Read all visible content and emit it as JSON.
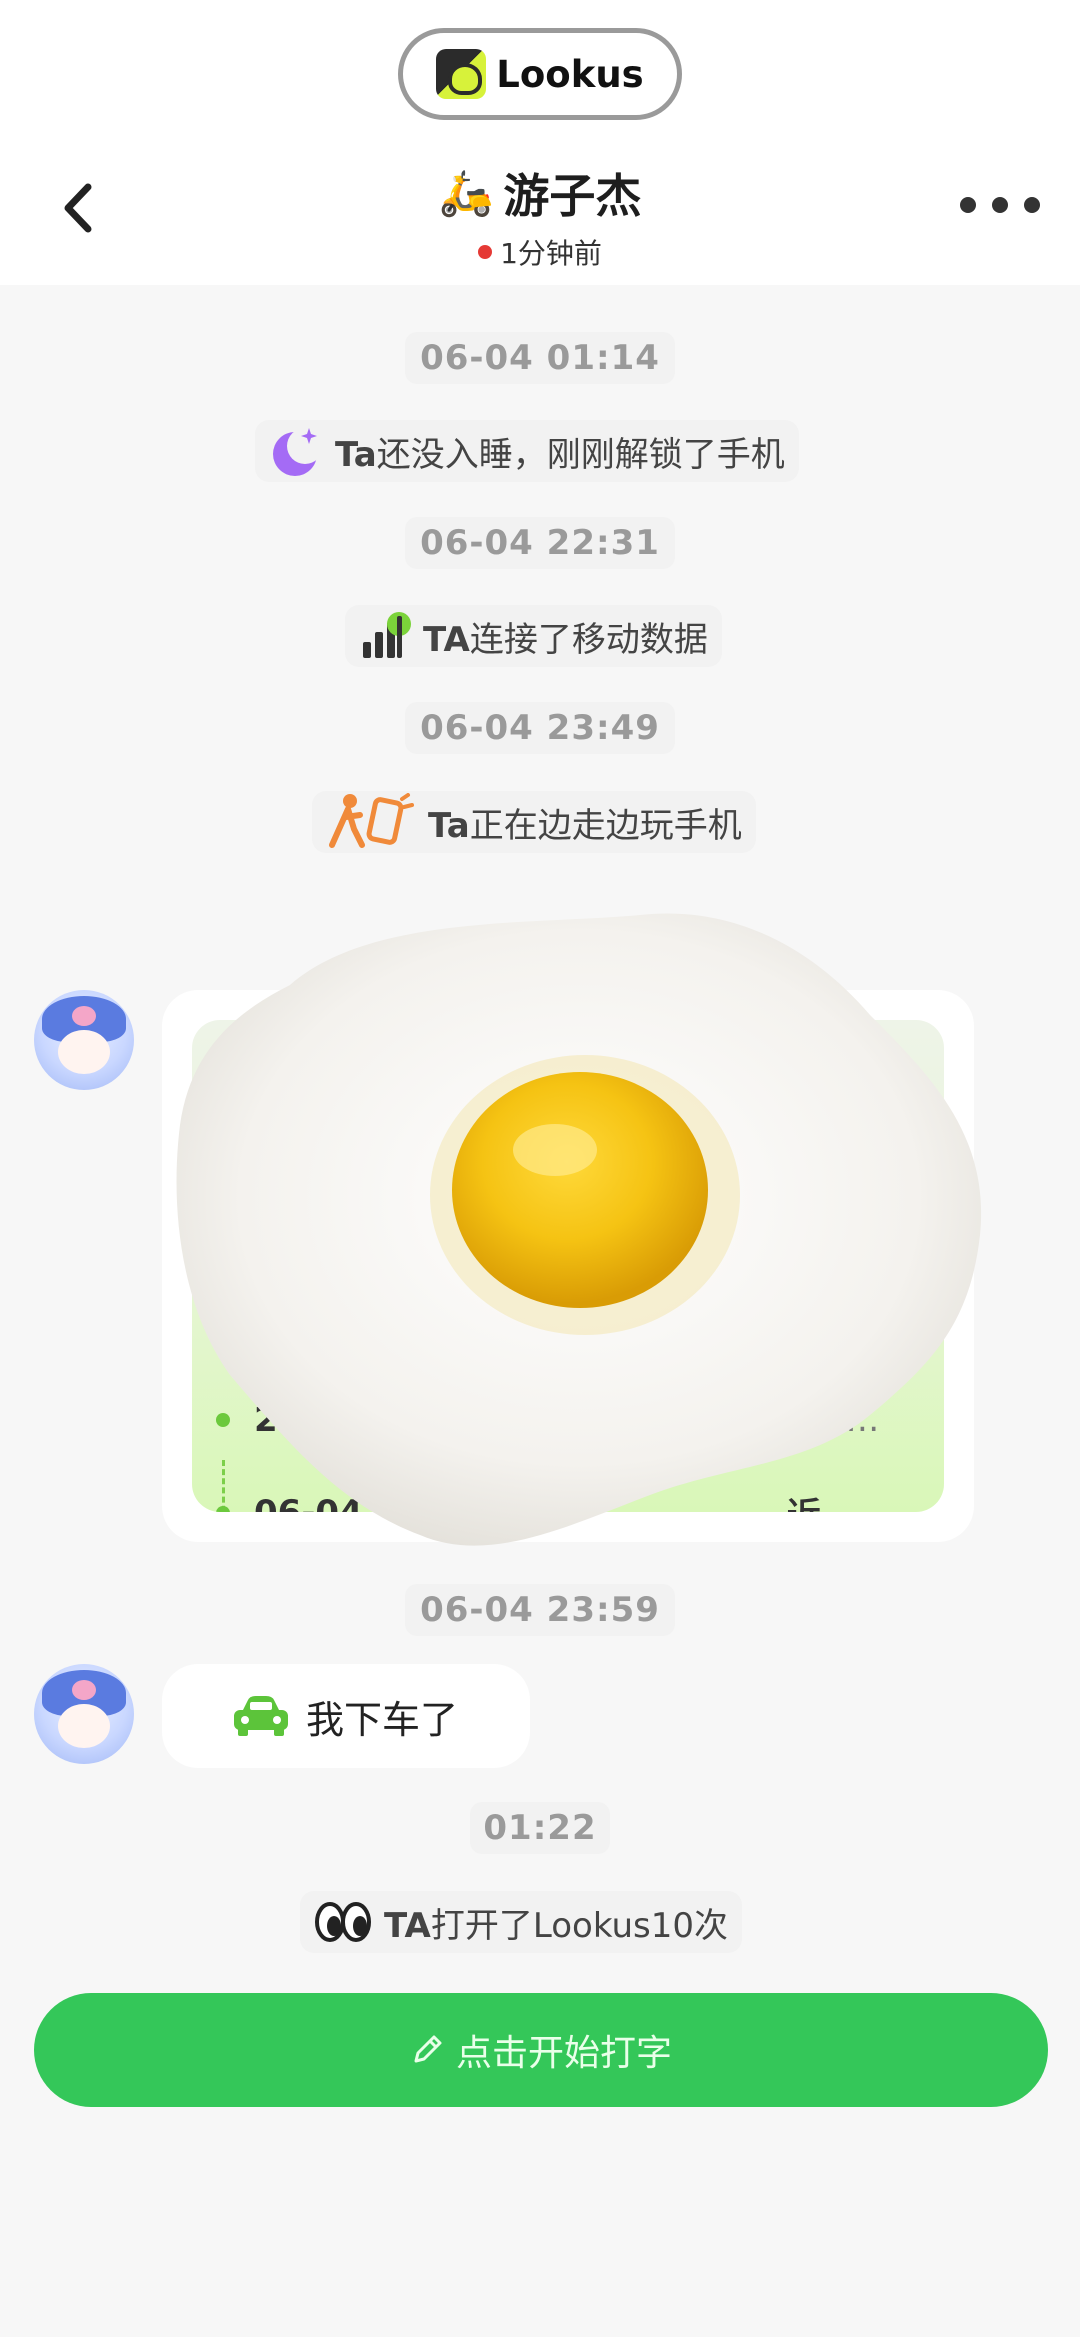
{
  "app": {
    "name": "Lookus"
  },
  "header": {
    "title_emoji": "🛵",
    "title": "游子杰",
    "status": "1分钟前",
    "status_color": "#e53935"
  },
  "timeline": [
    {
      "time": "06-04 01:14",
      "event": {
        "icon": "moon-icon",
        "prefix": "Ta",
        "text": "还没入睡，刚刚解锁了手机"
      }
    },
    {
      "time": "06-04 22:31",
      "event": {
        "icon": "signal-icon",
        "prefix": "TA",
        "text": "连接了移动数据"
      }
    },
    {
      "time": "06-04 23:49",
      "event": {
        "icon": "walking-phone-icon",
        "prefix": "Ta",
        "text": "正在边走边玩手机"
      }
    }
  ],
  "location_card": {
    "route": [
      {
        "time": "23",
        "place": "…"
      },
      {
        "time": "06-04",
        "place": "近"
      }
    ]
  },
  "message_time": "06-04 23:59",
  "message": {
    "icon": "car-icon",
    "text": "我下车了"
  },
  "last": {
    "time": "01:22",
    "icon": "eyes-icon",
    "prefix": "TA",
    "text": "打开了Lookus10次"
  },
  "input": {
    "label": "点击开始打字",
    "icon": "pencil-icon"
  },
  "colors": {
    "accent": "#34c759",
    "background": "#f7f7f7"
  }
}
